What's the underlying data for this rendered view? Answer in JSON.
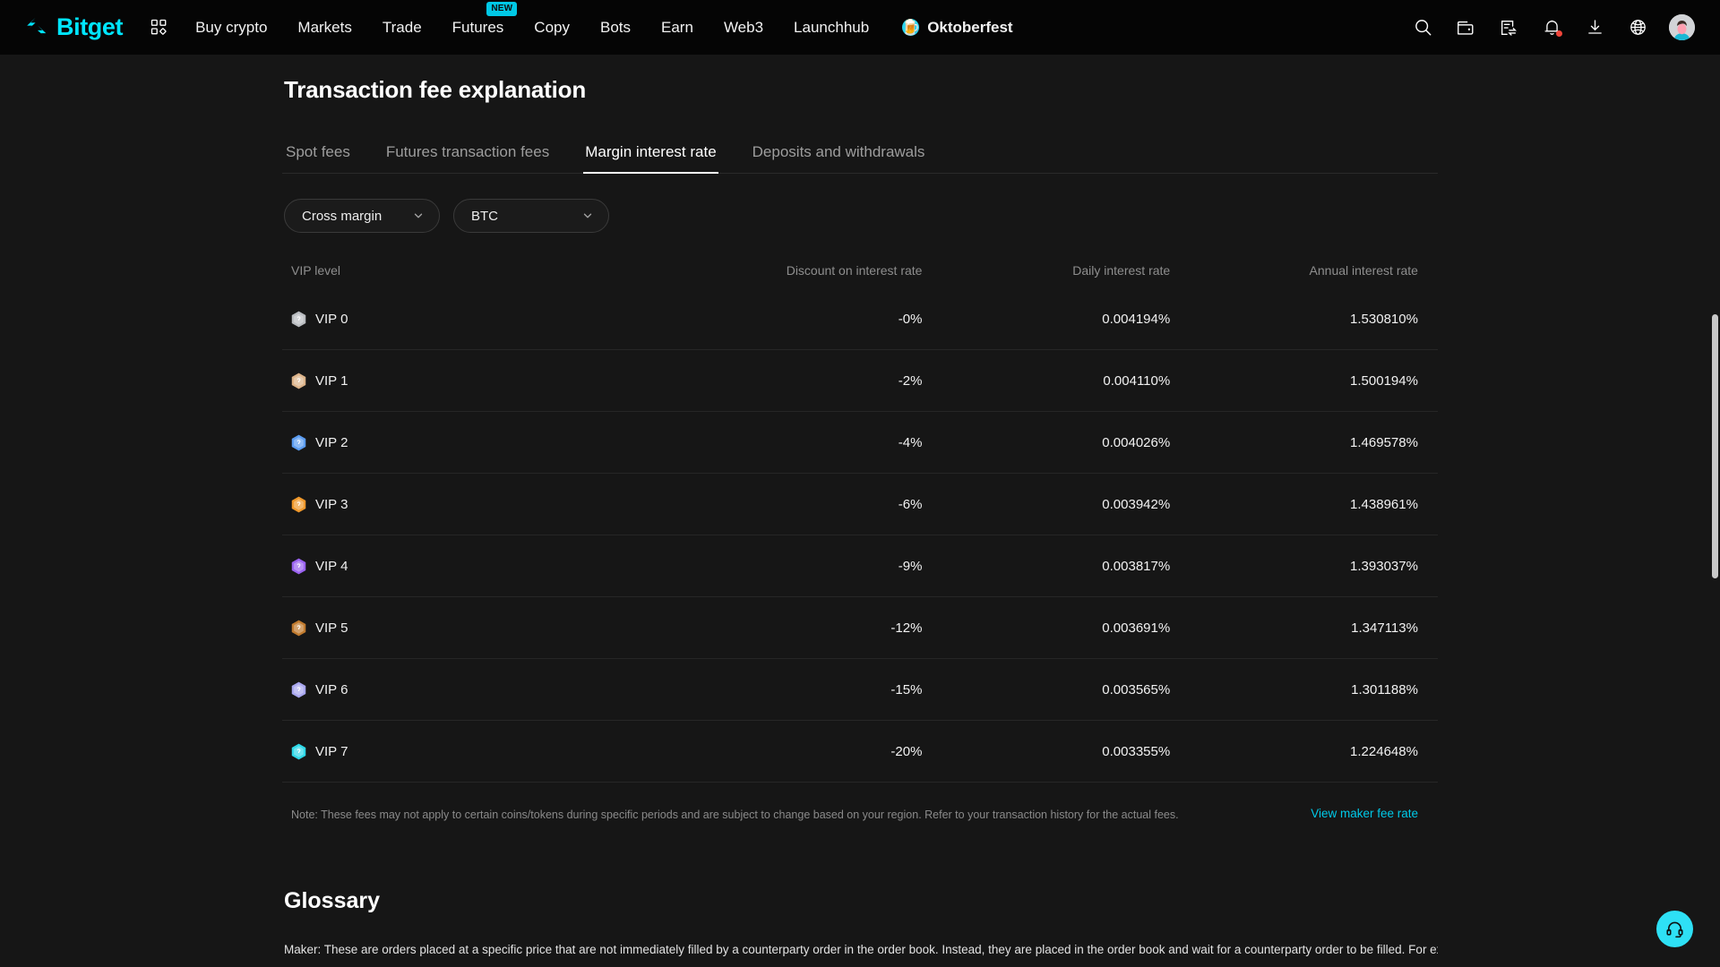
{
  "brand": {
    "name": "Bitget",
    "accent": "#00e5ff"
  },
  "nav": {
    "items": [
      {
        "label": "Buy crypto",
        "badge": null
      },
      {
        "label": "Markets",
        "badge": null
      },
      {
        "label": "Trade",
        "badge": null
      },
      {
        "label": "Futures",
        "badge": "NEW"
      },
      {
        "label": "Copy",
        "badge": null
      },
      {
        "label": "Bots",
        "badge": null
      },
      {
        "label": "Earn",
        "badge": null
      },
      {
        "label": "Web3",
        "badge": null
      },
      {
        "label": "Launchhub",
        "badge": null
      }
    ],
    "promo": {
      "label": "Oktoberfest",
      "icon": "beer-mug-icon"
    },
    "right_icons": [
      "search-icon",
      "wallet-icon",
      "orders-icon",
      "notifications-bell-icon",
      "download-icon",
      "language-globe-icon",
      "user-avatar"
    ]
  },
  "page": {
    "title": "Transaction fee explanation"
  },
  "tabs": [
    {
      "label": "Spot fees",
      "active": false
    },
    {
      "label": "Futures transaction fees",
      "active": false
    },
    {
      "label": "Margin interest rate",
      "active": true
    },
    {
      "label": "Deposits and withdrawals",
      "active": false
    }
  ],
  "filters": [
    {
      "name": "margin-mode-select",
      "value": "Cross margin"
    },
    {
      "name": "coin-select",
      "value": "BTC"
    }
  ],
  "table": {
    "columns": [
      "VIP level",
      "Discount on interest rate",
      "Daily interest rate",
      "Annual interest rate"
    ],
    "rows": [
      {
        "vip": "VIP 0",
        "badge_color": "#b9bcc0",
        "discount": "-0%",
        "daily": "0.004194%",
        "annual": "1.530810%"
      },
      {
        "vip": "VIP 1",
        "badge_color": "#dcb389",
        "discount": "-2%",
        "daily": "0.004110%",
        "annual": "1.500194%"
      },
      {
        "vip": "VIP 2",
        "badge_color": "#5b9cf0",
        "discount": "-4%",
        "daily": "0.004026%",
        "annual": "1.469578%"
      },
      {
        "vip": "VIP 3",
        "badge_color": "#f0982a",
        "discount": "-6%",
        "daily": "0.003942%",
        "annual": "1.438961%"
      },
      {
        "vip": "VIP 4",
        "badge_color": "#9a62f0",
        "discount": "-9%",
        "daily": "0.003817%",
        "annual": "1.393037%"
      },
      {
        "vip": "VIP 5",
        "badge_color": "#c07a2e",
        "discount": "-12%",
        "daily": "0.003691%",
        "annual": "1.347113%"
      },
      {
        "vip": "VIP 6",
        "badge_color": "#a8a6ef",
        "discount": "-15%",
        "daily": "0.003565%",
        "annual": "1.301188%"
      },
      {
        "vip": "VIP 7",
        "badge_color": "#2ed9e8",
        "discount": "-20%",
        "daily": "0.003355%",
        "annual": "1.224648%"
      }
    ]
  },
  "footer": {
    "note": "Note: These fees may not apply to certain coins/tokens during specific periods and are subject to change based on your region. Refer to your transaction history for the actual fees.",
    "maker_link": "View maker fee rate",
    "link_color": "#00c9e8"
  },
  "glossary": {
    "title": "Glossary",
    "paragraph": "Maker: These are orders placed at a specific price that are not immediately filled by a counterparty order in the order book. Instead, they are placed in the order book and wait for a counterparty order to be filled. For example,"
  },
  "support": {
    "icon": "headset-icon",
    "color": "#2ee0f5"
  }
}
